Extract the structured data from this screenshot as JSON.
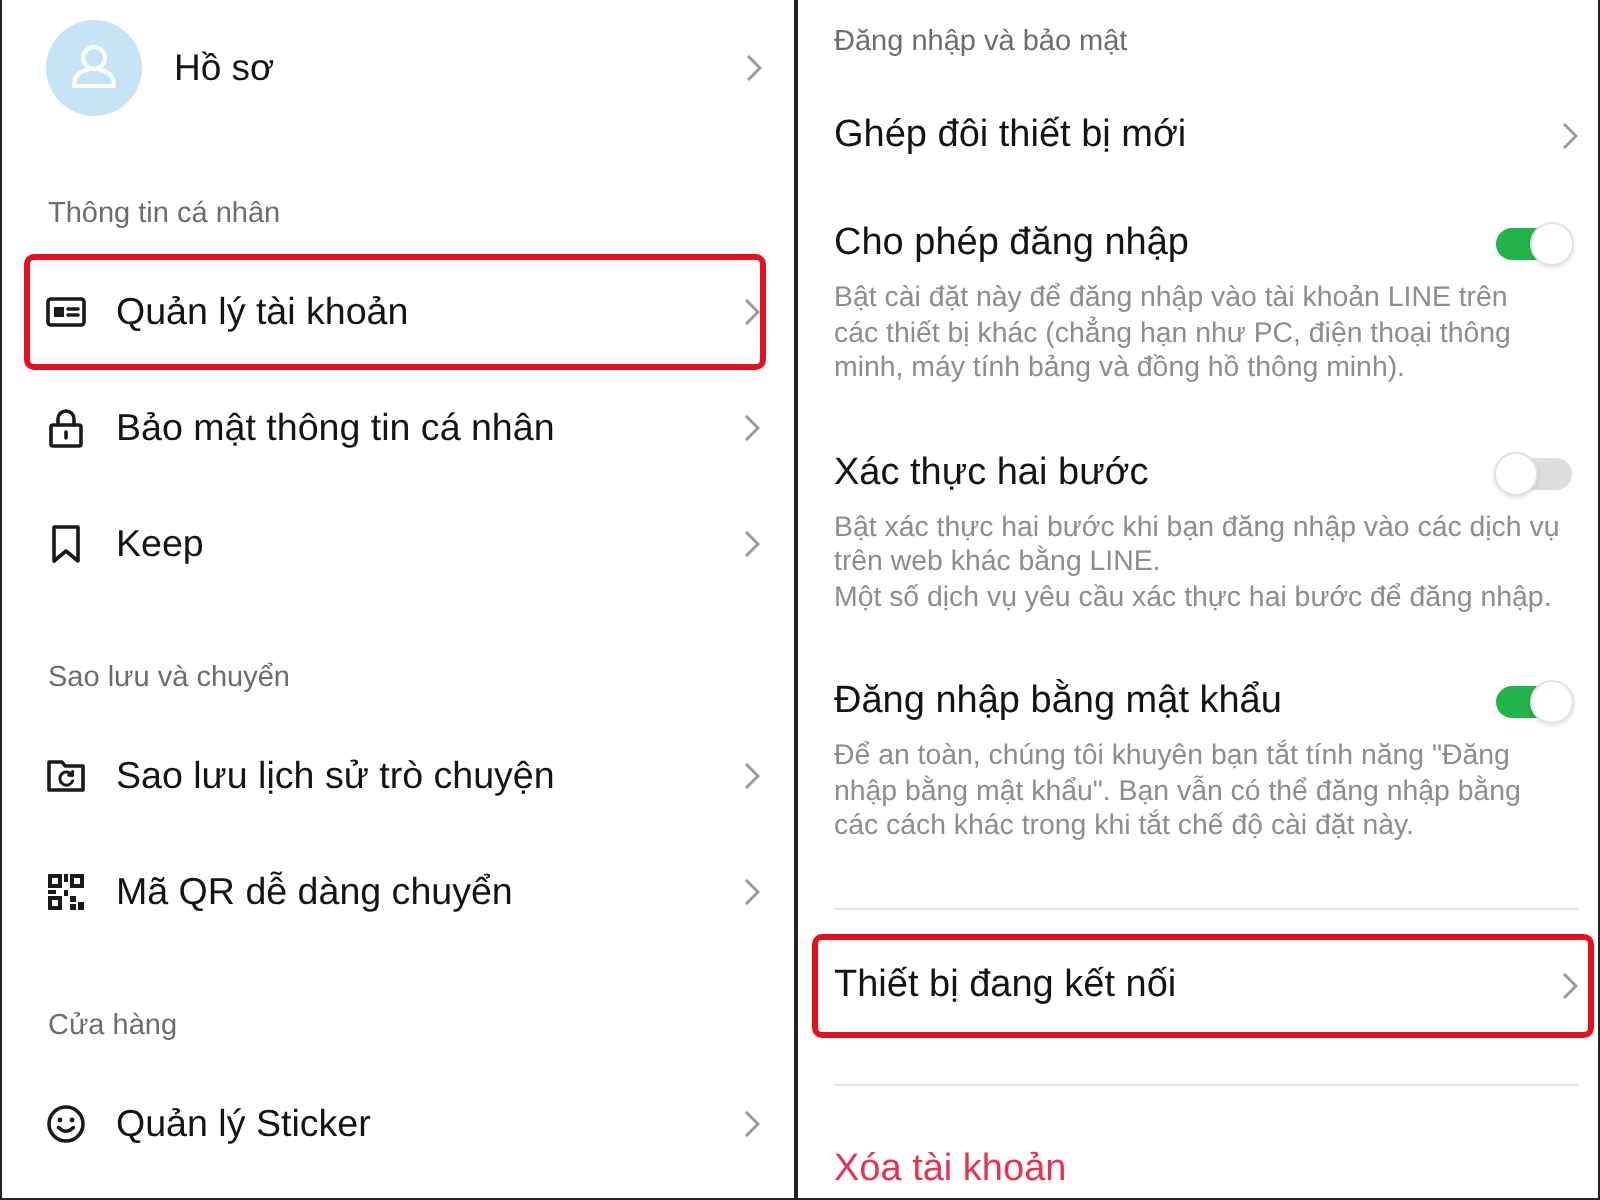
{
  "left_panel": {
    "profile": {
      "label": "Hồ sơ"
    },
    "sections": [
      {
        "title": "Thông tin cá nhân",
        "items": [
          {
            "label": "Quản lý tài khoản",
            "highlighted": true
          },
          {
            "label": "Bảo mật thông tin cá nhân",
            "highlighted": false
          },
          {
            "label": "Keep",
            "highlighted": false
          }
        ]
      },
      {
        "title": "Sao lưu và chuyển",
        "items": [
          {
            "label": "Sao lưu lịch sử trò chuyện",
            "highlighted": false
          },
          {
            "label": "Mã QR dễ dàng chuyển",
            "highlighted": false
          }
        ]
      },
      {
        "title": "Cửa hàng",
        "items": [
          {
            "label": "Quản lý Sticker",
            "highlighted": false
          }
        ]
      }
    ]
  },
  "right_panel": {
    "groups": [
      {
        "title": "Đăng nhập và bảo mật",
        "items": [
          {
            "kind": "link",
            "label": "Ghép đôi thiết bị mới",
            "highlighted": false
          },
          {
            "kind": "toggle",
            "label": "Cho phép đăng nhập",
            "on": true,
            "description": "Bật cài đặt này để đăng nhập vào tài khoản LINE trên\ncác thiết bị khác (chẳng hạn như PC, điện thoại thông\nminh, máy tính bảng và đồng hồ thông minh)."
          },
          {
            "kind": "toggle",
            "label": "Xác thực hai bước",
            "on": false,
            "description": "Bật xác thực hai bước khi bạn đăng nhập vào các dịch vụ\ntrên web khác bằng LINE.\nMột số dịch vụ yêu cầu xác thực hai bước để đăng nhập."
          },
          {
            "kind": "toggle",
            "label": "Đăng nhập bằng mật khẩu",
            "on": true,
            "description": "Để an toàn, chúng tôi khuyên bạn tắt tính năng \"Đăng\nnhập bằng mật khẩu\". Bạn vẫn có thể đăng nhập bằng\ncác cách khác trong khi tắt chế độ cài đặt này."
          }
        ]
      },
      {
        "items": [
          {
            "kind": "link",
            "label": "Thiết bị đang kết nối",
            "highlighted": true
          }
        ]
      },
      {
        "items": [
          {
            "kind": "danger",
            "label": "Xóa tài khoản",
            "highlighted": false
          }
        ]
      }
    ]
  }
}
